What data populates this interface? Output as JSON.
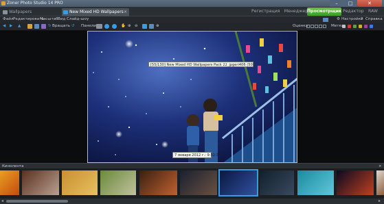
{
  "window": {
    "title": "Zoner Photo Studio 14 PRO",
    "close_glyph": "✕"
  },
  "tabs": [
    {
      "label": "Wallpapers"
    },
    {
      "label": "New Mixed HD Wallpapers F...",
      "close": "×"
    }
  ],
  "modes": {
    "registration": "Регистрация",
    "manager": "Менеджер",
    "viewer": "Просмотрщик",
    "editor": "Редактор",
    "raw": "RAW"
  },
  "menu": [
    "Файл",
    "Редактировать",
    "Масштаб",
    "Вид",
    "Слайд-шоу"
  ],
  "menu_right": {
    "settings": "Настройки",
    "help": "Справка"
  },
  "toolbar": {
    "rotate": "Вращать",
    "panel": "Панели",
    "rating": "Оценка",
    "label": "Метка"
  },
  "viewer": {
    "filename": "[55/130] New Mixed HD Wallpapers Pack 22_jpgeri406 (50).jpg",
    "date": "7 января 2012 г.: 9:52:32"
  },
  "filmstrip": {
    "title": "Кинолента",
    "pin": "×",
    "thumbs": [
      {
        "name": "orange",
        "colors": [
          "#e8a020",
          "#c44a10"
        ]
      },
      {
        "name": "cake",
        "colors": [
          "#5a3020",
          "#b8a090"
        ]
      },
      {
        "name": "gold-text",
        "colors": [
          "#c89030",
          "#e8c060"
        ]
      },
      {
        "name": "sheep",
        "colors": [
          "#6a8a3a",
          "#c0c0a0"
        ]
      },
      {
        "name": "bundt-cake",
        "colors": [
          "#3a2010",
          "#c06030"
        ]
      },
      {
        "name": "woman-dress",
        "colors": [
          "#1a2030",
          "#6a5040"
        ]
      },
      {
        "name": "night-sky",
        "colors": [
          "#0a1840",
          "#3050a0"
        ]
      },
      {
        "name": "dark-figure",
        "colors": [
          "#10202a",
          "#3a4a60"
        ]
      },
      {
        "name": "frog",
        "colors": [
          "#1a8aa0",
          "#60c8d8"
        ]
      },
      {
        "name": "fireworks",
        "colors": [
          "#0a0a20",
          "#c04020"
        ]
      },
      {
        "name": "woman-white",
        "colors": [
          "#e0d8d0",
          "#8a6040"
        ]
      }
    ]
  }
}
